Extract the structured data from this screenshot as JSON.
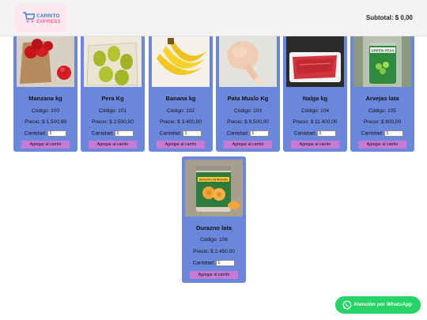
{
  "header": {
    "logo_line1": "CARRITO",
    "logo_line2": "EXPRESS",
    "subtotal_label": "Subtotal: $ 0,00"
  },
  "products": [
    {
      "name": "Manzana kg",
      "code": "Código: 100",
      "price": "Precio: $ 1.500,99",
      "qty_label": "Cantidad:",
      "qty": "1",
      "button": "Agregar al carrito"
    },
    {
      "name": "Pera Kg",
      "code": "Código: 101",
      "price": "Precio: $ 2.500,00",
      "qty_label": "Cantidad:",
      "qty": "1",
      "button": "Agregar al carrito"
    },
    {
      "name": "Banana kg",
      "code": "Código: 102",
      "price": "Precio: $ 3.400,00",
      "qty_label": "Cantidad:",
      "qty": "1",
      "button": "Agregar al carrito"
    },
    {
      "name": "Pata Muslo Kg",
      "code": "Código: 103",
      "price": "Precio: $ 9.500,00",
      "qty_label": "Cantidad:",
      "qty": "1",
      "button": "Agregar al carrito"
    },
    {
      "name": "Nalga kg",
      "code": "Código: 104",
      "price": "Precio: $ 11.400,00",
      "qty_label": "Cantidad:",
      "qty": "1",
      "button": "Agregar al carrito"
    },
    {
      "name": "Arvejas lata",
      "code": "Código: 105",
      "price": "Precio: $ 800,00",
      "qty_label": "Cantidad:",
      "qty": "1",
      "button": "Agregar al carrito"
    },
    {
      "name": "Durazno lata",
      "code": "Código: 106",
      "price": "Precio: $ 2.450,00",
      "qty_label": "Cantidad:",
      "qty": "1",
      "button": "Agregar al carrito"
    }
  ],
  "photo_labels": {
    "arvejas": "GREEN PEAS",
    "durazno": "DURAZNO EN MITADES"
  },
  "whatsapp": {
    "label": "Atención por WhatsApp",
    "icon": "whatsapp-icon"
  },
  "colors": {
    "card_bg": "#6b87dc",
    "button_bg": "#c57ad6",
    "whatsapp_bg": "#25d366",
    "logo_blue": "#3b7fd9",
    "logo_pink": "#f06ba0"
  }
}
